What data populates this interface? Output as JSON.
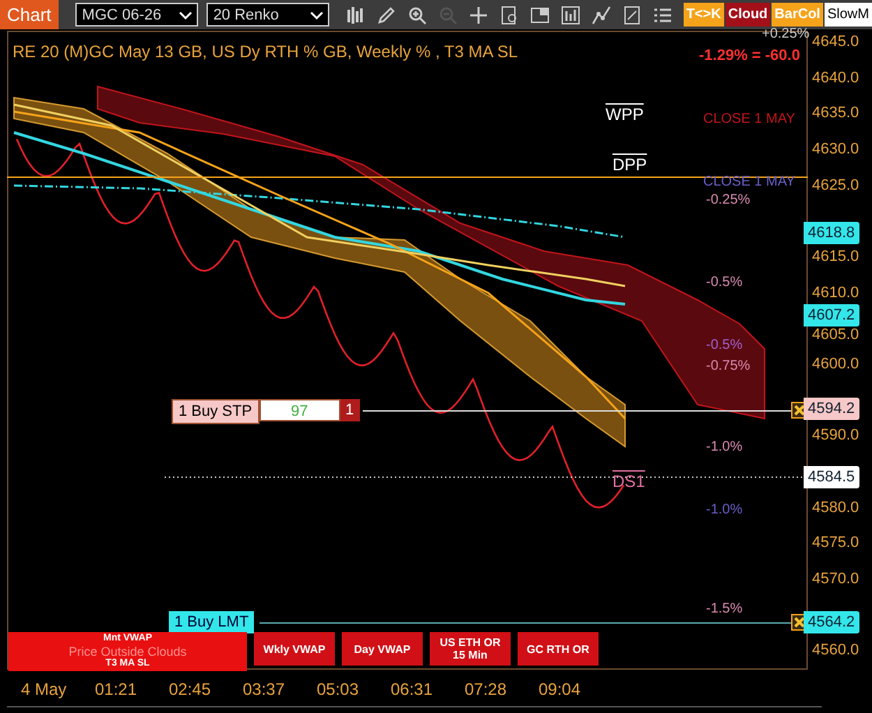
{
  "toolbar": {
    "tab": "Chart",
    "instrument": "MGC 06-26",
    "period": "20 Renko",
    "toggles": [
      {
        "label": "T<>K",
        "color": "#f5a31a"
      },
      {
        "label": "Cloud",
        "color": "#a3101a"
      },
      {
        "label": "BarCol",
        "color": "#f5a31a"
      },
      {
        "label": "SlowM",
        "color": "#ffffff"
      }
    ]
  },
  "chart": {
    "title": "RE 20  (M)GC May 13 GB, US Dy RTH % GB, Weekly % , T3 MA SL",
    "change_top": "+0.25%",
    "change": "-1.29% = -60.0",
    "levels": [
      {
        "label": "WPP",
        "color": "#ffffff"
      },
      {
        "label": "CLOSE 1 MAY",
        "color": "#c0151c"
      },
      {
        "label": "DPP",
        "color": "#ffffff"
      },
      {
        "label": "CLOSE 1 MAY",
        "color": "#6a5fc8"
      },
      {
        "label": "-0.25%",
        "color": "#d98ab0"
      },
      {
        "label": "-0.5%",
        "color": "#d98ab0"
      },
      {
        "label": "-0.5%",
        "color": "#a060d0"
      },
      {
        "label": "-0.75%",
        "color": "#d98ab0"
      },
      {
        "label": "-1.0%",
        "color": "#d98ab0"
      },
      {
        "label": "DS1",
        "color": "#e070a0"
      },
      {
        "label": "-1.0%",
        "color": "#6a5fc8"
      },
      {
        "label": "-1.5%",
        "color": "#d98ab0"
      }
    ],
    "orders": [
      {
        "kind": "stop",
        "label": "1 Buy STP",
        "quantity": "97",
        "count": "1"
      },
      {
        "kind": "limit",
        "label": "1 Buy LMT"
      }
    ],
    "signal_panel": [
      "Mnt VWAP",
      "Price Outside Clouds",
      "T3 MA SL"
    ],
    "indicator_buttons": [
      "Wkly VWAP",
      "Day VWAP",
      "US ETH OR 15 Min",
      "GC RTH OR"
    ]
  },
  "price_axis": {
    "ticks": [
      "4645.0",
      "4640.0",
      "4635.0",
      "4630.0",
      "4625.0",
      "4615.0",
      "4610.0",
      "4605.0",
      "4600.0",
      "4590.0",
      "4580.0",
      "4575.0",
      "4570.0",
      "4560.0"
    ],
    "markers": [
      {
        "value": "4618.8",
        "color": "#33e6ea"
      },
      {
        "value": "4607.2",
        "color": "#33e6ea"
      },
      {
        "value": "4594.2",
        "color": "#f7c8c8"
      },
      {
        "value": "4584.5",
        "color": "#ffffff"
      },
      {
        "value": "4564.2",
        "color": "#33e6ea"
      }
    ]
  },
  "time_axis": [
    "4 May",
    "01:21",
    "02:45",
    "03:37",
    "05:03",
    "06:31",
    "07:28",
    "09:04"
  ]
}
